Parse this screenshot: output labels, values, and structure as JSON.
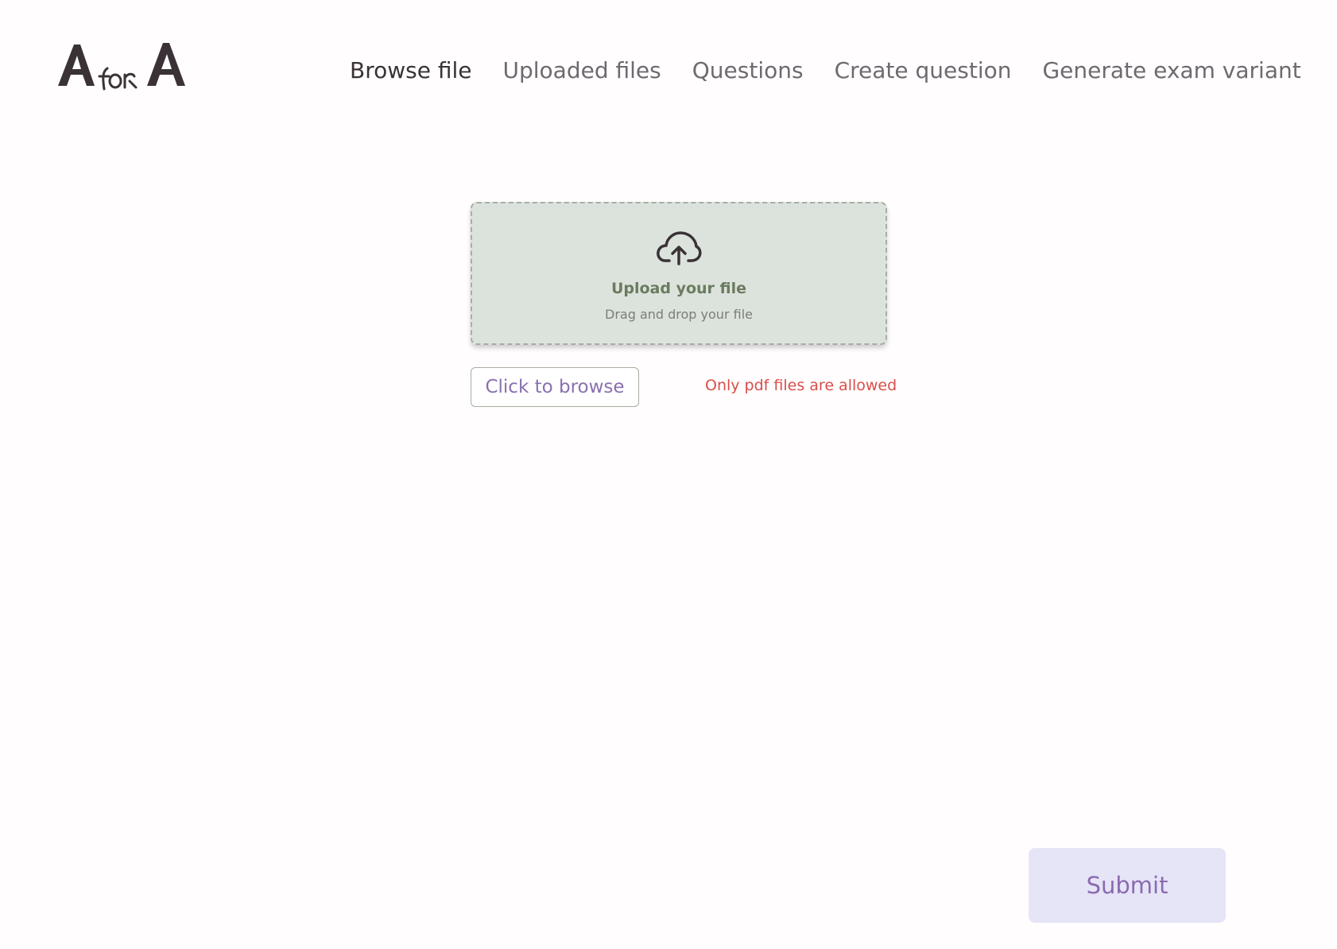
{
  "brand": {
    "logo_text": "A for A"
  },
  "nav": {
    "items": [
      {
        "label": "Browse file",
        "active": true
      },
      {
        "label": "Uploaded files",
        "active": false
      },
      {
        "label": "Questions",
        "active": false
      },
      {
        "label": "Create question",
        "active": false
      },
      {
        "label": "Generate exam variant",
        "active": false
      }
    ]
  },
  "dropzone": {
    "icon": "cloud-upload-icon",
    "title": "Upload your file",
    "subtitle": "Drag and drop your file"
  },
  "browse": {
    "label": "Click to browse"
  },
  "validation": {
    "message": "Only pdf files are allowed"
  },
  "submit": {
    "label": "Submit"
  },
  "colors": {
    "dropzone_bg": "#dce3dc",
    "accent_purple": "#8a6bb0",
    "error_red": "#d94e4a",
    "submit_bg": "#e6e4f7"
  }
}
